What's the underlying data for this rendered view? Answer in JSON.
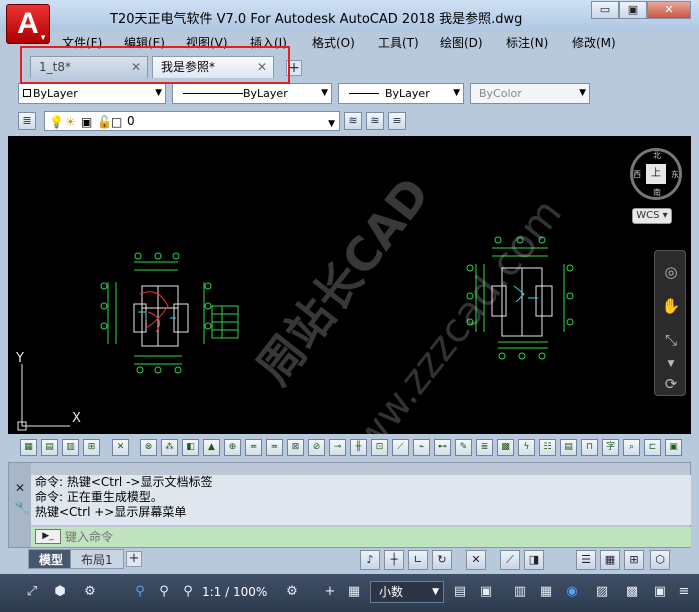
{
  "window": {
    "title": "T20天正电气软件 V7.0 For Autodesk AutoCAD 2018     我是参照.dwg",
    "app_logo": "A",
    "buttons": [
      "▭",
      "▣",
      "✕"
    ]
  },
  "menu": {
    "items": [
      "文件(F)",
      "编辑(E)",
      "视图(V)",
      "插入(I)",
      "格式(O)",
      "工具(T)",
      "绘图(D)",
      "标注(N)",
      "修改(M)"
    ]
  },
  "doc_tabs": [
    {
      "label": "1_t8*",
      "active": false
    },
    {
      "label": "我是参照*",
      "active": true
    }
  ],
  "properties": {
    "color": "ByLayer",
    "linetype": "ByLayer",
    "lineweight": "ByLayer",
    "plotstyle": "ByColor"
  },
  "layer": {
    "current": "0"
  },
  "canvas": {
    "watermark_1": "周站长CAD",
    "watermark_2": "www.zzzcad.com",
    "viewcube": {
      "face": "上",
      "north": "北",
      "south": "南",
      "west": "西",
      "east": "东"
    },
    "wcs_label": "WCS",
    "ucs": {
      "x_label": "X",
      "y_label": "Y"
    }
  },
  "command": {
    "history": [
      "命令: 热键<Ctrl ->显示文档标签",
      "命令: 正在重生成模型。",
      "热键<Ctrl +>显示屏幕菜单"
    ],
    "prompt_icon": "▶_",
    "placeholder": "键入命令"
  },
  "layout_tabs": [
    {
      "label": "模型",
      "active": true
    },
    {
      "label": "布局1",
      "active": false
    }
  ],
  "status": {
    "scale": "1:1 / 100%",
    "units": "小数"
  },
  "colors": {
    "canvas_bg": "#000000",
    "highlight": "#e32020",
    "chrome": "#b9c9dc"
  }
}
